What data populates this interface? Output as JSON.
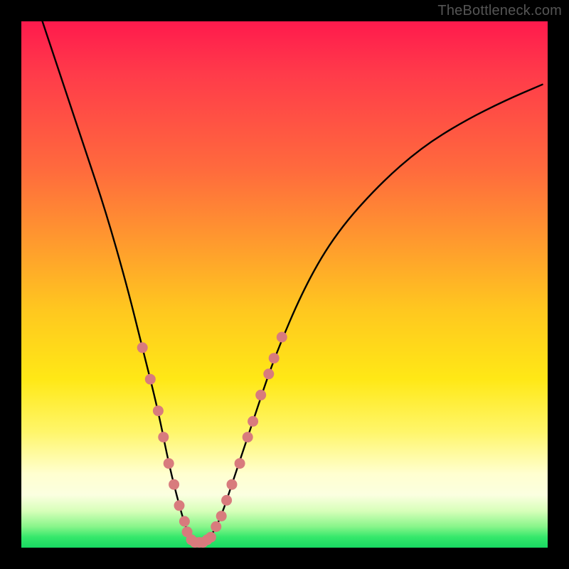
{
  "watermark": "TheBottleneck.com",
  "chart_data": {
    "type": "line",
    "title": "",
    "xlabel": "",
    "ylabel": "",
    "xlim": [
      0,
      100
    ],
    "ylim": [
      0,
      100
    ],
    "note": "Figure is a bottleneck-style V-curve over a red→green vertical gradient. No numeric axis ticks are rendered in the image; curve samples below are read from pixel geometry as (x%, y%) where y=0 is the bottom (green) and y=100 is the top (red).",
    "series": [
      {
        "name": "bottleneck-curve",
        "x": [
          4,
          8,
          12,
          16,
          20,
          23,
          26,
          28,
          30,
          31.5,
          33,
          34.5,
          36,
          38,
          40,
          44,
          48,
          54,
          60,
          68,
          76,
          84,
          92,
          99
        ],
        "y": [
          100,
          88,
          76,
          64,
          50,
          38,
          26,
          16,
          8,
          3,
          1,
          1,
          2,
          6,
          12,
          24,
          36,
          50,
          60,
          69,
          76,
          81,
          85,
          88
        ]
      }
    ],
    "markers": {
      "note": "Pink nodules clustered on both flanks of the V near the bottom and across the trough.",
      "left_flank": [
        {
          "x": 23,
          "y": 38
        },
        {
          "x": 24.5,
          "y": 32
        },
        {
          "x": 26,
          "y": 26
        },
        {
          "x": 27,
          "y": 21
        },
        {
          "x": 28,
          "y": 16
        },
        {
          "x": 29,
          "y": 12
        },
        {
          "x": 30,
          "y": 8
        },
        {
          "x": 31,
          "y": 5
        }
      ],
      "trough": [
        {
          "x": 31.5,
          "y": 3
        },
        {
          "x": 32.3,
          "y": 1.5
        },
        {
          "x": 33,
          "y": 1
        },
        {
          "x": 33.8,
          "y": 1
        },
        {
          "x": 34.5,
          "y": 1
        },
        {
          "x": 35.3,
          "y": 1.5
        },
        {
          "x": 36,
          "y": 2
        }
      ],
      "right_flank": [
        {
          "x": 37,
          "y": 4
        },
        {
          "x": 38,
          "y": 6
        },
        {
          "x": 39,
          "y": 9
        },
        {
          "x": 40,
          "y": 12
        },
        {
          "x": 41.5,
          "y": 16
        },
        {
          "x": 43,
          "y": 21
        },
        {
          "x": 44,
          "y": 24
        },
        {
          "x": 45.5,
          "y": 29
        },
        {
          "x": 47,
          "y": 33
        },
        {
          "x": 48,
          "y": 36
        },
        {
          "x": 49.5,
          "y": 40
        }
      ]
    },
    "gradient_stops": [
      {
        "pos": 0,
        "color": "#ff1a4d"
      },
      {
        "pos": 50,
        "color": "#ffc81f"
      },
      {
        "pos": 86,
        "color": "#ffffd0"
      },
      {
        "pos": 100,
        "color": "#18d862"
      }
    ]
  }
}
